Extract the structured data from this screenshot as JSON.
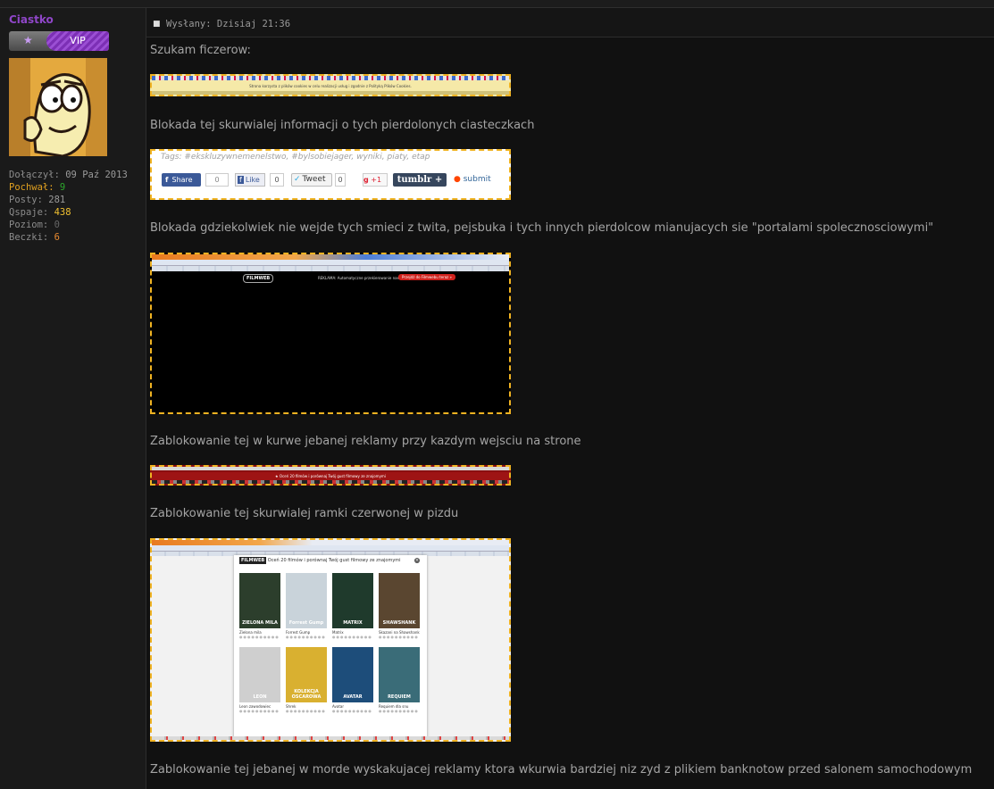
{
  "sidebar": {
    "username": "Ciastko",
    "rank_label": "VIP",
    "stats": [
      {
        "label": "Dołączył:",
        "value": "09 Paź 2013",
        "color": "#9a9a9a"
      },
      {
        "label": "Pochwał:",
        "value": "9",
        "color": "#2ca82c",
        "label_color": "#e0a020"
      },
      {
        "label": "Posty:",
        "value": "281",
        "color": "#9a9a9a"
      },
      {
        "label": "Qspaje:",
        "value": "438",
        "color": "#f0c030"
      },
      {
        "label": "Poziom:",
        "value": "0",
        "color": "#666666"
      },
      {
        "label": "Beczki:",
        "value": "6",
        "color": "#e88a30"
      }
    ]
  },
  "post": {
    "posted_label": "Wysłany: Dzisiaj 21:36",
    "paragraphs": [
      "Szukam ficzerow:",
      "Blokada tej skurwialej informacji o tych pierdolonych ciasteczkach",
      "Blokada gdziekolwiek nie wejde tych smieci z twita, pejsbuka i tych innych pierdolcow mianujacych sie \"portalami spolecznosciowymi\"",
      "Zablokowanie tej w kurwe jebanej reklamy przy kazdym wejsciu na strone",
      "Zablokowanie tej skurwialej ramki czerwonej w pizdu",
      "Zablokowanie tej jebanej w morde wyskakujacej reklamy ktora wkurwia bardziej niz zyd z plikiem banknotow przed salonem samochodowym"
    ]
  },
  "social_widget": {
    "tags": "Tags: #ekskluzywnemenelstwo, #bylsobiejager, wyniki, piaty, etap",
    "share_label": "Share",
    "share_count": "0",
    "like_label": "Like",
    "like_count": "0",
    "tweet_label": "Tweet",
    "tweet_count": "0",
    "gplus_label": "+1",
    "tumblr_label": "tumblr",
    "submit_label": "submit"
  },
  "filmweb_popup": {
    "brand": "FILMWEB",
    "heading": "Oceń 20 filmów i porównaj Twój gust filmowy ze znajomymi",
    "movies": [
      {
        "title": "Zielona mila",
        "poster_text": "ZIELONA MILA",
        "color": "#2c3e2c"
      },
      {
        "title": "Forrest Gump",
        "poster_text": "Forrest Gump",
        "color": "#c9d3da"
      },
      {
        "title": "Matrix",
        "poster_text": "MATRIX",
        "color": "#1f3a2c"
      },
      {
        "title": "Skazani na Shawshank",
        "poster_text": "SHAWSHANK",
        "color": "#5a4630"
      },
      {
        "title": "Leon zawodowiec",
        "poster_text": "LEON",
        "color": "#cfcfcf"
      },
      {
        "title": "Shrek",
        "poster_text": "KOLEKCJA OSCAROWA",
        "color": "#d9b030"
      },
      {
        "title": "Avatar",
        "poster_text": "AVATAR",
        "color": "#1d4d7a"
      },
      {
        "title": "Requiem dla snu",
        "poster_text": "REQUIEM",
        "color": "#3a6c78"
      }
    ]
  },
  "cookie_bar_text": "Strona korzysta z plików cookies w celu realizacji usług i zgodnie z Polityką Plików Cookies.",
  "filmweb_ad": {
    "brand": "FILMWEB",
    "notice": "REKLAMA: Automatyczne przekierowanie nastąpi za 16 sekund",
    "button": "Przejdź do Filmwebu teraz »"
  },
  "red_frame_text": "Oceń 20 filmów i porównaj Twój gust filmowy ze znajomymi"
}
